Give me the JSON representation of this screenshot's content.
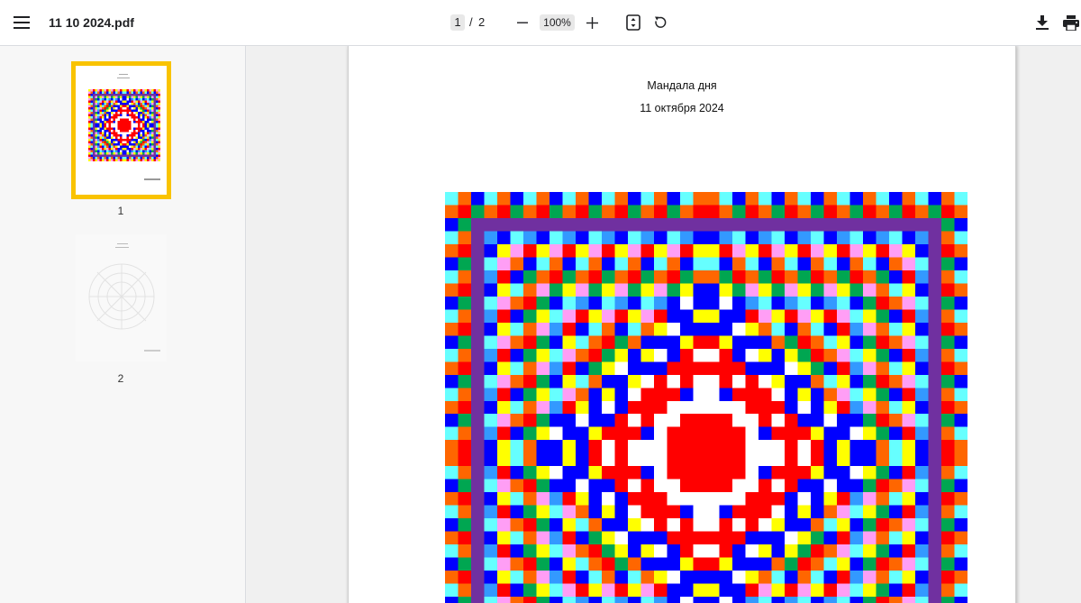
{
  "toolbar": {
    "file_name": "11 10 2024.pdf",
    "current_page": "1",
    "page_separator": "/",
    "total_pages": "2",
    "zoom": "100%"
  },
  "icons": {
    "menu": "menu-icon",
    "zoom_out": "minus-icon",
    "zoom_in": "plus-icon",
    "fit": "fit-page-icon",
    "rotate": "rotate-icon",
    "download": "download-icon",
    "print": "print-icon"
  },
  "sidebar": {
    "thumbnails": [
      {
        "label": "1",
        "selected": true
      },
      {
        "label": "2",
        "selected": false
      }
    ]
  },
  "document": {
    "title": "Мандала дня",
    "date": "11 октября 2024"
  },
  "colors": {
    "selection": "#f9c300",
    "mandala_palette": [
      "#ff0000",
      "#0000ff",
      "#ffff00",
      "#00a651",
      "#ff9ef5",
      "#66ffff",
      "#7030a0",
      "#ff6600",
      "#3399ff",
      "#ffffff"
    ]
  }
}
